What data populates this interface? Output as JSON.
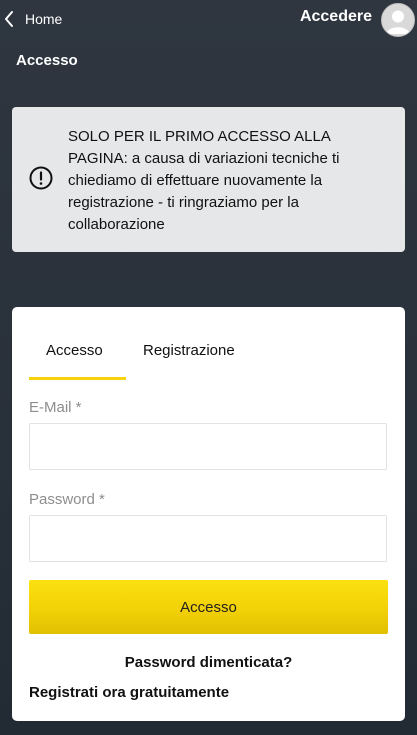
{
  "header": {
    "back_label": "Home",
    "login_label": "Accedere"
  },
  "page": {
    "title": "Accesso"
  },
  "notice": {
    "text": "SOLO PER IL PRIMO ACCESSO ALLA PAGINA: a causa di variazioni tecniche ti chiediamo di effettuare nuovamente la registrazione - ti ringraziamo per la collaborazione",
    "icon": "alert-circle-icon"
  },
  "form": {
    "tabs": [
      {
        "label": "Accesso",
        "active": true
      },
      {
        "label": "Registrazione",
        "active": false
      }
    ],
    "email_label": "E-Mail *",
    "email_value": "",
    "password_label": "Password *",
    "password_value": "",
    "submit_label": "Accesso",
    "forgot_label": "Password dimenticata?",
    "register_label": "Registrati ora gratuitamente"
  },
  "colors": {
    "background": "#2f3640",
    "notice_bg": "#e6e7e8",
    "accent_yellow": "#f5d20a",
    "card_bg": "#ffffff"
  }
}
